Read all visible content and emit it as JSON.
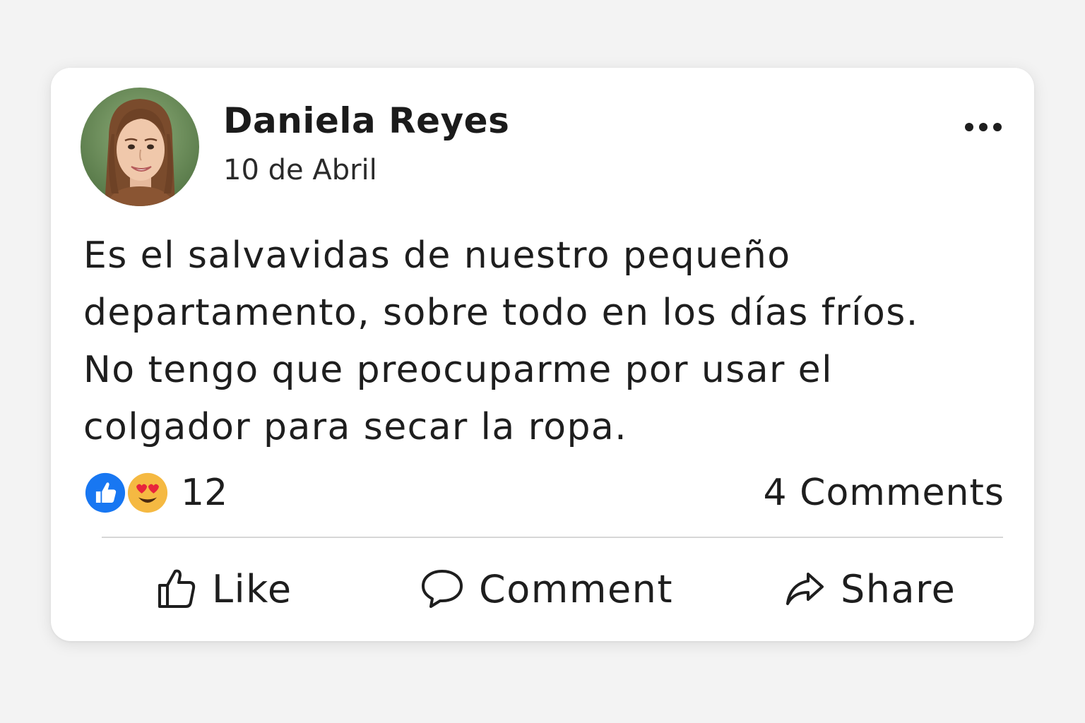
{
  "post": {
    "author_name": "Daniela Reyes",
    "date": "10 de Abril",
    "text_lines": [
      "Es el salvavidas de nuestro pequeño",
      "departamento, sobre todo en los días fríos.",
      "No tengo que preocuparme por usar el",
      "colgador para secar la ropa."
    ],
    "more_icon": "more-horizontal-icon"
  },
  "reactions": {
    "icons": [
      "like-reaction-icon",
      "love-eyes-reaction-icon"
    ],
    "count": "12",
    "comments_label": "4 Comments"
  },
  "actions": {
    "like_label": "Like",
    "comment_label": "Comment",
    "share_label": "Share"
  },
  "colors": {
    "like_blue": "#1877f2",
    "emoji_yellow": "#f5b942",
    "heart_red": "#e8243c",
    "divider": "#d7d7d7",
    "background": "#f3f3f3",
    "card": "#ffffff"
  }
}
